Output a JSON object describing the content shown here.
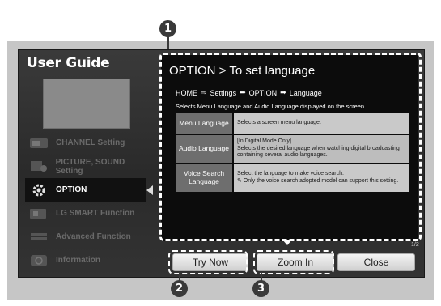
{
  "user_guide": {
    "title": "User Guide",
    "menu": [
      {
        "label": "CHANNEL Setting",
        "icon": "channel-icon",
        "active": false
      },
      {
        "label": "PICTURE, SOUND Setting",
        "icon": "picture-sound-icon",
        "active": false
      },
      {
        "label": "OPTION",
        "icon": "gear-icon",
        "active": true
      },
      {
        "label": "LG SMART Function",
        "icon": "smart-icon",
        "active": false
      },
      {
        "label": "Advanced Function",
        "icon": "advanced-icon",
        "active": false
      },
      {
        "label": "Information",
        "icon": "info-icon",
        "active": false
      }
    ]
  },
  "content": {
    "title": "OPTION > To set language",
    "breadcrumb": {
      "home": "HOME",
      "arrow1": "⇨",
      "settings": "Settings",
      "arrow2": "➡",
      "option": "OPTION",
      "arrow3": "➡",
      "language": "Language"
    },
    "description": "Selects Menu Language and Audio Language displayed on the screen.",
    "rows": [
      {
        "key": "Menu Language",
        "lines": [
          "Selects a screen menu language."
        ]
      },
      {
        "key": "Audio Language",
        "lines": [
          "[In Digital Mode Only]",
          "Selects the desired language when watching digital broadcasting containing several audio languages."
        ]
      },
      {
        "key": "Voice Search Language",
        "lines": [
          "Select the language to make voice search.",
          "✎ Only the voice search adopted model can support this setting."
        ]
      }
    ],
    "pager": "1/2"
  },
  "buttons": {
    "try_now": "Try Now",
    "zoom_in": "Zoom In",
    "close": "Close"
  },
  "callouts": {
    "one": "1",
    "two": "2",
    "three": "3"
  }
}
